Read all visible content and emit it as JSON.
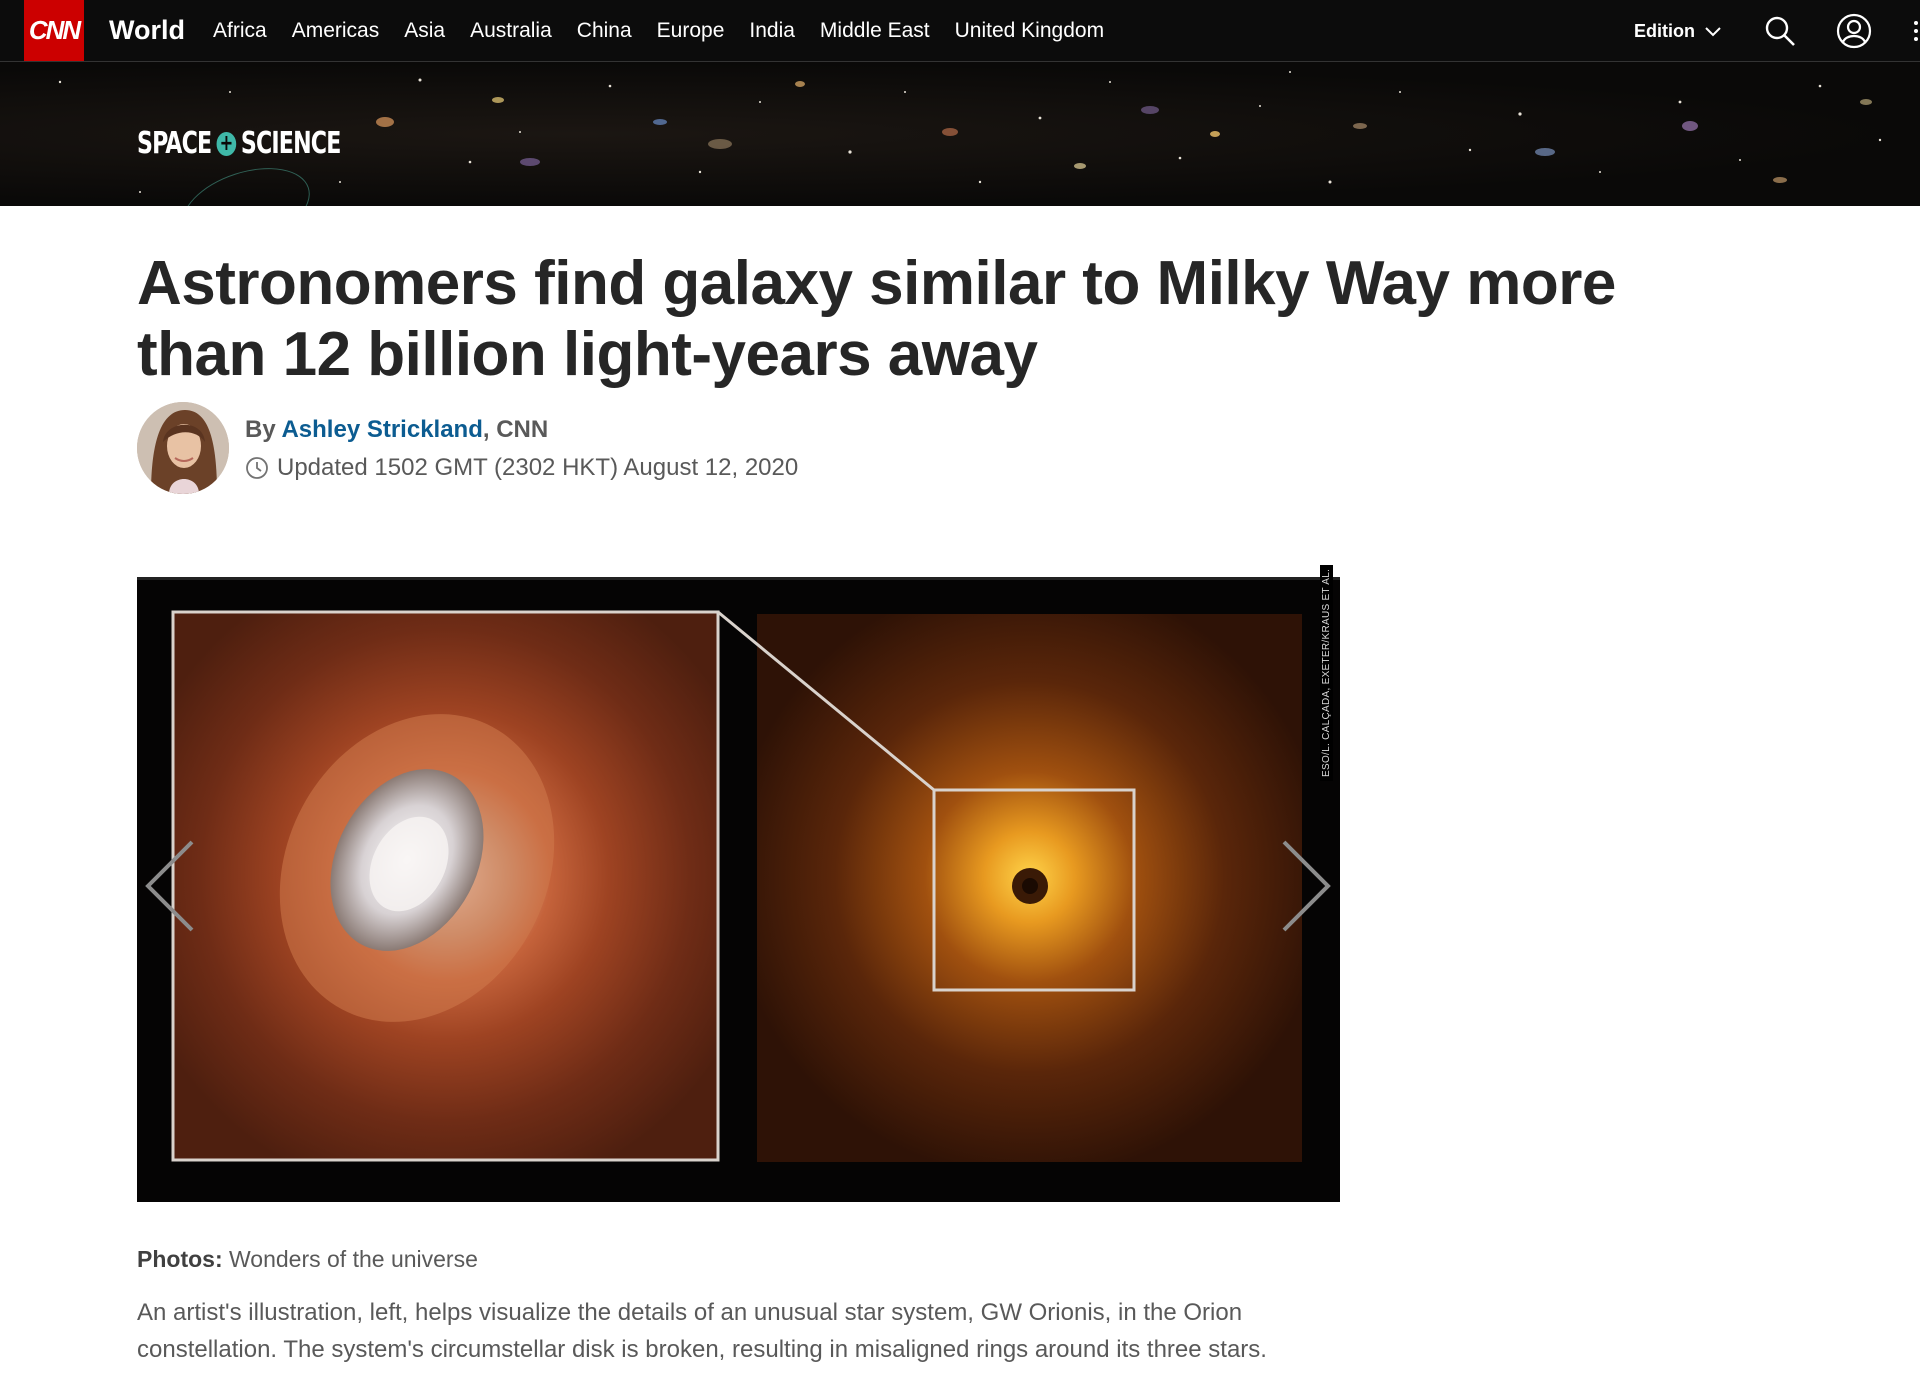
{
  "nav": {
    "logo": "CNN",
    "section": "World",
    "links": [
      "Africa",
      "Americas",
      "Asia",
      "Australia",
      "China",
      "Europe",
      "India",
      "Middle East",
      "United Kingdom"
    ],
    "edition_label": "Edition",
    "icons": [
      "search-icon",
      "account-icon",
      "more-icon"
    ]
  },
  "banner": {
    "brand_left": "SPACE",
    "brand_plus": "+",
    "brand_right": "SCIENCE"
  },
  "article": {
    "headline": "Astronomers find galaxy similar to Milky Way more than 12 billion light-years away",
    "byline_prefix": "By ",
    "author": "Ashley Strickland",
    "outlet": ", CNN",
    "updated": "Updated 1502 GMT (2302 HKT) August 12, 2020"
  },
  "gallery": {
    "credit": "ESO/L. CALÇADA, EXETER/KRAUS ET AL.",
    "caption_label": "Photos:",
    "caption_title": " Wonders of the universe",
    "caption_text": "An artist's illustration, left, helps visualize the details of an unusual star system, GW Orionis, in the Orion constellation. The system's circumstellar disk is broken, resulting in misaligned rings around its three stars."
  },
  "colors": {
    "brand_red": "#cc0000",
    "nav_bg": "#0c0c0c",
    "author_link": "#0c5c91",
    "headline": "#262626"
  }
}
